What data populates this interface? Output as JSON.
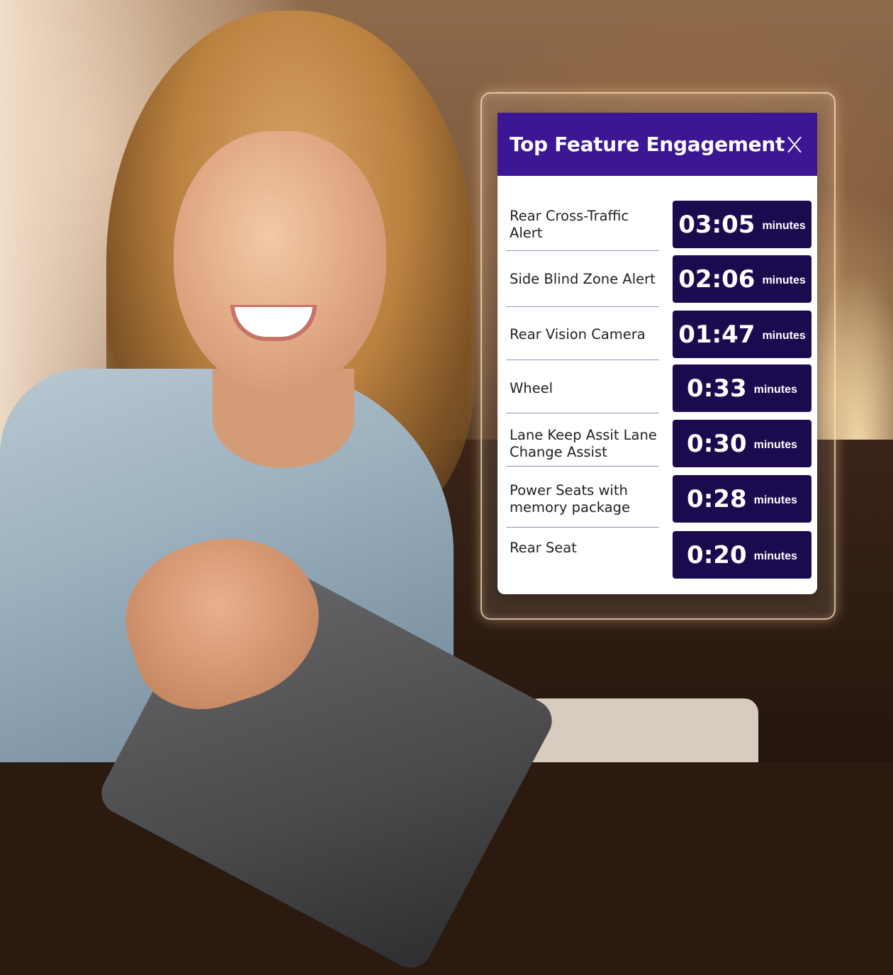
{
  "card": {
    "title": "Top Feature Engagement",
    "close_label": "X"
  },
  "features": [
    {
      "label": "Rear Cross-Traffic Alert",
      "time": "03:05",
      "unit": "minutes"
    },
    {
      "label": "Side Blind Zone Alert",
      "time": "02:06",
      "unit": "minutes"
    },
    {
      "label": "Rear Vision Camera",
      "time": "01:47",
      "unit": "minutes"
    },
    {
      "label": "Wheel",
      "time": "0:33",
      "unit": "minutes"
    },
    {
      "label": "Lane Keep Assit Lane Change Assist",
      "time": "0:30",
      "unit": "minutes"
    },
    {
      "label": "Power Seats with memory package",
      "time": "0:28",
      "unit": "minutes"
    },
    {
      "label": "Rear Seat",
      "time": "0:20",
      "unit": "minutes"
    }
  ],
  "colors": {
    "header": "#3b1695",
    "time_box": "#1c0a4f",
    "divider": "#9a8fb3"
  }
}
